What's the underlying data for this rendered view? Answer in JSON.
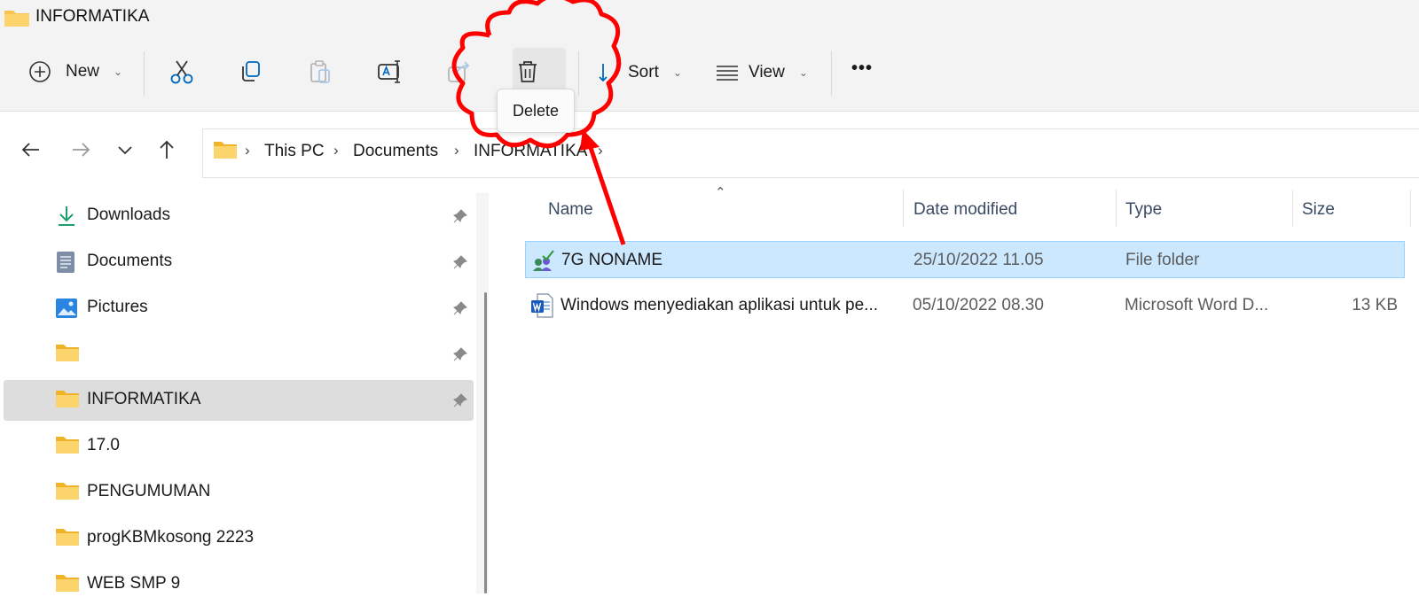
{
  "window": {
    "title": "INFORMATIKA"
  },
  "toolbar": {
    "new_label": "New",
    "sort_label": "Sort",
    "view_label": "View",
    "more_label": "•••",
    "delete_tooltip": "Delete",
    "icons": [
      "cut-icon",
      "copy-icon",
      "paste-icon",
      "rename-icon",
      "share-icon",
      "delete-icon"
    ]
  },
  "address": {
    "crumbs": [
      "This PC",
      "Documents",
      "INFORMATIKA"
    ]
  },
  "sidebar": {
    "items": [
      {
        "label": "Downloads",
        "icon": "download-icon",
        "pinned": true
      },
      {
        "label": "Documents",
        "icon": "documents-icon",
        "pinned": true
      },
      {
        "label": "Pictures",
        "icon": "pictures-icon",
        "pinned": true
      },
      {
        "label": "",
        "icon": "folder-icon",
        "pinned": true
      },
      {
        "label": "INFORMATIKA",
        "icon": "folder-icon",
        "pinned": true,
        "selected": true
      },
      {
        "label": "17.0",
        "icon": "folder-icon",
        "pinned": false
      },
      {
        "label": "PENGUMUMAN",
        "icon": "folder-icon",
        "pinned": false
      },
      {
        "label": "progKBMkosong 2223",
        "icon": "folder-icon",
        "pinned": false
      },
      {
        "label": "WEB SMP 9",
        "icon": "folder-icon",
        "pinned": false
      }
    ]
  },
  "files": {
    "columns": [
      "Name",
      "Date modified",
      "Type",
      "Size"
    ],
    "rows": [
      {
        "name": "7G NONAME",
        "date": "25/10/2022 11.05",
        "type": "File folder",
        "size": "",
        "icon": "shared-folder-icon",
        "selected": true
      },
      {
        "name": "Windows menyediakan aplikasi untuk pe...",
        "date": "05/10/2022 08.30",
        "type": "Microsoft Word D...",
        "size": "13 KB",
        "icon": "word-doc-icon",
        "selected": false
      }
    ]
  },
  "colors": {
    "selection": "#cce8ff",
    "selection_border": "#99d1ff",
    "annotation": "#ff0000",
    "folder": "#f8c44f",
    "accent": "#0067c0"
  }
}
